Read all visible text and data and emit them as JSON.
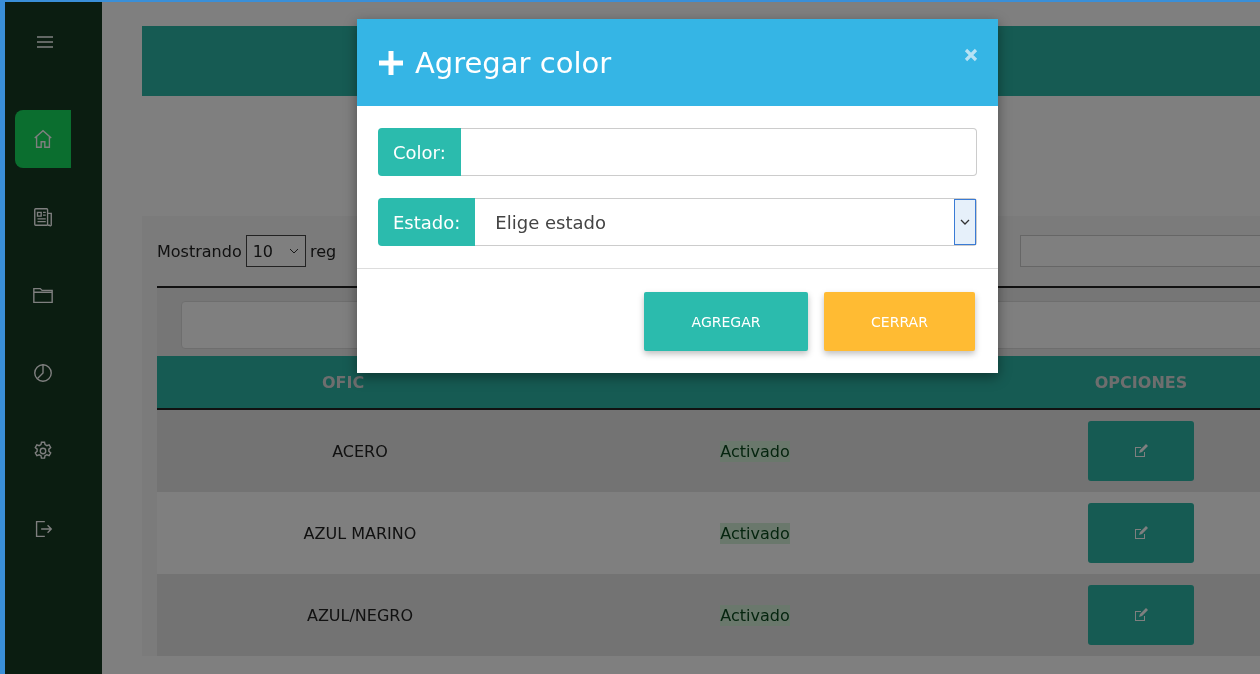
{
  "sidebar": {
    "items": [
      {
        "kind": "home",
        "selected": true
      },
      {
        "kind": "newspaper",
        "selected": false
      },
      {
        "kind": "folder",
        "selected": false
      },
      {
        "kind": "chart",
        "selected": false
      },
      {
        "kind": "settings",
        "selected": false
      },
      {
        "kind": "logout",
        "selected": false
      }
    ]
  },
  "table_controls": {
    "show_label": "Mostrando",
    "page_size": "10",
    "after_label": "reg"
  },
  "table": {
    "header": {
      "column_1": "OFIC",
      "column_3": "OPCIONES"
    },
    "rows": [
      {
        "name": "ACERO",
        "status": "Activado"
      },
      {
        "name": "AZUL MARINO",
        "status": "Activado"
      },
      {
        "name": "AZUL/NEGRO",
        "status": "Activado"
      }
    ]
  },
  "modal": {
    "title": "Agregar color",
    "fields": [
      {
        "kind": "text",
        "label": "Color:"
      },
      {
        "kind": "select",
        "label": "Estado:",
        "value": "Elige estado"
      }
    ],
    "buttons": [
      {
        "kind": "primary",
        "label": "AGREGAR"
      },
      {
        "kind": "warning",
        "label": "CERRAR"
      }
    ]
  }
}
